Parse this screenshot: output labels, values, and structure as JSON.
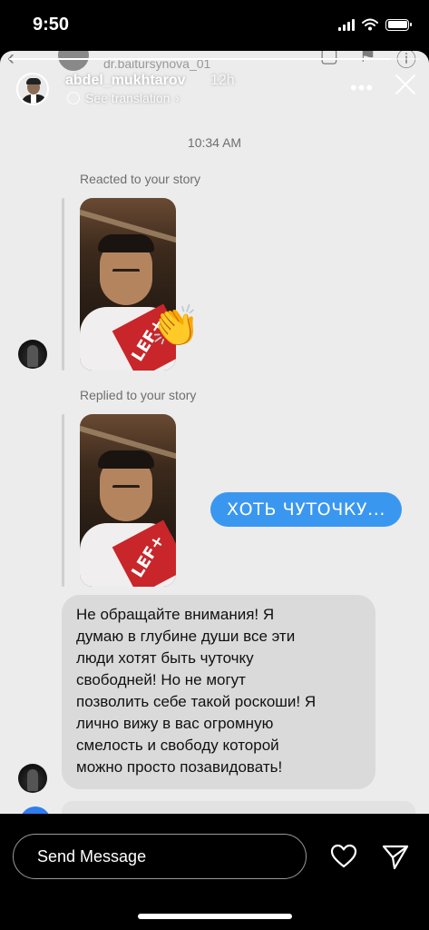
{
  "status_bar": {
    "time": "9:50"
  },
  "underlying_chat": {
    "handle": "dr.baitursynova_01"
  },
  "story": {
    "username": "abdel_mukhtarov",
    "time_ago": "12h",
    "see_translation": "See translation",
    "progress": 0.93
  },
  "thread": {
    "timestamp": "10:34 AM",
    "reacted_notice": "Reacted to your story",
    "reaction_emoji": "👏",
    "replied_notice": "Replied to your story",
    "thumb_logo_text": "LEF+",
    "outgoing_message": "ХОТЬ ЧУТОЧКУ...",
    "incoming_message": "Не обращайте внимания! Я\nдумаю в глубине души все эти\nлюди хотят быть чуточку\nсвободней! Но не могут\nпозволить себе такой роскоши! Я\nлично вижу в вас огромную\nсмелость и свободу которой\nможно просто позавидовать!"
  },
  "composer": {
    "placeholder": "Send Message"
  },
  "icons": {
    "close": "close-icon",
    "more": "more-icon",
    "heart": "heart-icon",
    "send": "send-icon",
    "globe": "globe-icon"
  },
  "colors": {
    "outgoing_bubble": "#3a97f0",
    "incoming_bubble": "#dadada",
    "chat_background": "#ececec"
  }
}
